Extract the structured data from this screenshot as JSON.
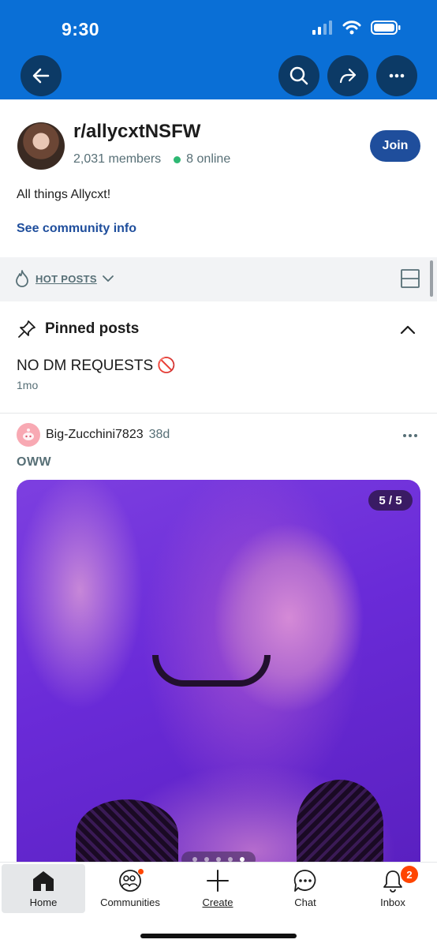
{
  "status_bar": {
    "time": "9:30"
  },
  "community": {
    "name": "r/allycxtNSFW",
    "members": "2,031 members",
    "online": "8 online",
    "join_label": "Join",
    "description": "All things Allycxt!",
    "info_link": "See community info"
  },
  "sort": {
    "label": "HOT POSTS"
  },
  "pinned": {
    "header": "Pinned posts",
    "post_title": "NO DM REQUESTS 🚫",
    "post_age": "1mo"
  },
  "post": {
    "username": "Big-Zucchini7823",
    "age": "38d",
    "title": "OWW",
    "gallery_counter": "5 / 5",
    "gallery_total": 5,
    "gallery_current": 5
  },
  "bottom_nav": {
    "items": [
      {
        "label": "Home"
      },
      {
        "label": "Communities"
      },
      {
        "label": "Create"
      },
      {
        "label": "Chat"
      },
      {
        "label": "Inbox"
      }
    ],
    "inbox_badge": "2"
  },
  "colors": {
    "header_blue": "#0a6fd6",
    "join_blue": "#1f4e9c",
    "online_green": "#2eb873",
    "badge_orange": "#ff4500"
  }
}
